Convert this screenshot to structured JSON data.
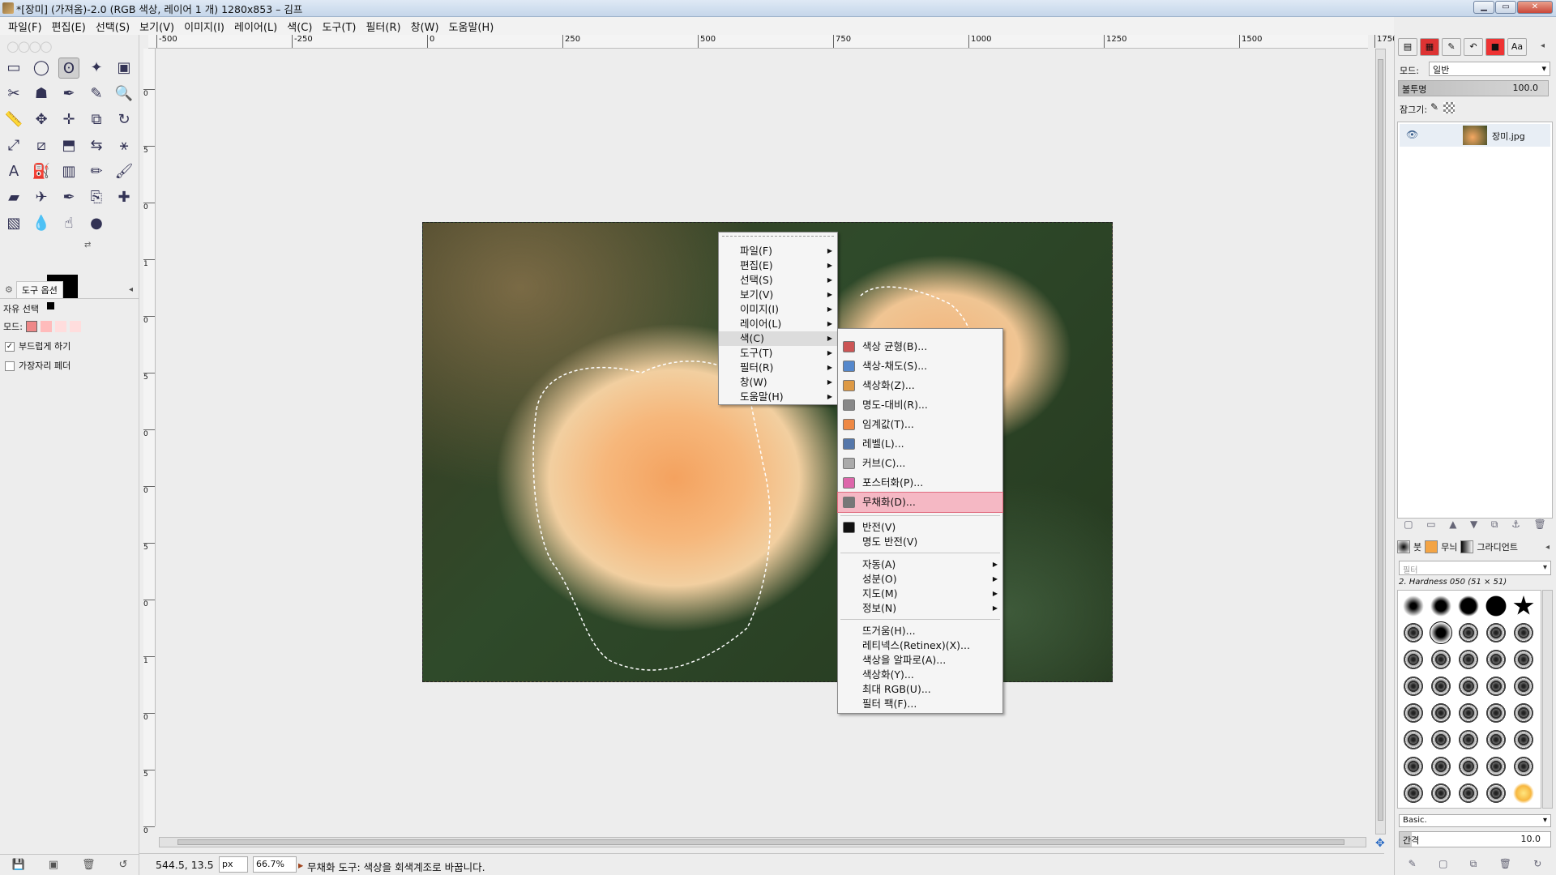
{
  "window": {
    "title": "*[장미] (가져옴)-2.0 (RGB 색상, 레이어 1 개) 1280x853 – 김프",
    "min": "▁",
    "max": "▭",
    "close": "✕"
  },
  "menubar": [
    "파일(F)",
    "편집(E)",
    "선택(S)",
    "보기(V)",
    "이미지(I)",
    "레이어(L)",
    "색(C)",
    "도구(T)",
    "필터(R)",
    "창(W)",
    "도움말(H)"
  ],
  "toolbox": {
    "icons": [
      "rect-select",
      "ellipse-select",
      "free-select",
      "fuzzy-select",
      "color-select",
      "scissors",
      "foreground-select",
      "paths",
      "color-picker",
      "zoom",
      "measure",
      "move",
      "align",
      "crop",
      "rotate",
      "scale",
      "shear",
      "perspective",
      "flip",
      "cage",
      "text",
      "bucket-fill",
      "blend",
      "pencil",
      "paintbrush",
      "eraser",
      "airbrush",
      "ink",
      "clone",
      "heal",
      "perspective-clone",
      "blur",
      "smudge",
      "dodge-burn"
    ],
    "options_tab": "도구 옵션",
    "tool_name": "자유 선택",
    "mode_label": "모드:",
    "antialias_label": "부드럽게 하기",
    "feather_label": "가장자리 페더"
  },
  "ruler": {
    "h_labels": [
      "-500",
      "-250",
      "0",
      "250",
      "500",
      "750",
      "1000",
      "1250",
      "1500",
      "1750"
    ],
    "v_labels": [
      "0",
      "5",
      "0",
      "1",
      "0",
      "5",
      "0",
      "0",
      "5",
      "0",
      "1",
      "0",
      "5",
      "0"
    ]
  },
  "status": {
    "coords": "544.5, 13.5",
    "unit": "px",
    "zoom": "66.7%",
    "message": "무채화 도구: 색상을 회색계조로 바꿉니다."
  },
  "context_menu": {
    "items": [
      {
        "label": "파일(F)",
        "sub": true
      },
      {
        "label": "편집(E)",
        "sub": true
      },
      {
        "label": "선택(S)",
        "sub": true
      },
      {
        "label": "보기(V)",
        "sub": true
      },
      {
        "label": "이미지(I)",
        "sub": true
      },
      {
        "label": "레이어(L)",
        "sub": true
      },
      {
        "label": "색(C)",
        "sub": true,
        "active": true
      },
      {
        "label": "도구(T)",
        "sub": true
      },
      {
        "label": "필터(R)",
        "sub": true
      },
      {
        "label": "창(W)",
        "sub": true
      },
      {
        "label": "도움말(H)",
        "sub": true
      }
    ]
  },
  "color_menu": {
    "items": [
      {
        "label": "색상 균형(B)...",
        "icon": "color-balance-icon"
      },
      {
        "label": "색상-채도(S)...",
        "icon": "hue-saturation-icon"
      },
      {
        "label": "색상화(Z)...",
        "icon": "colorize-icon"
      },
      {
        "label": "명도-대비(R)...",
        "icon": "brightness-contrast-icon"
      },
      {
        "label": "임계값(T)...",
        "icon": "threshold-icon"
      },
      {
        "label": "레벨(L)...",
        "icon": "levels-icon"
      },
      {
        "label": "커브(C)...",
        "icon": "curves-icon"
      },
      {
        "label": "포스터화(P)...",
        "icon": "posterize-icon"
      },
      {
        "label": "무채화(D)...",
        "icon": "desaturate-icon",
        "highlight": true
      },
      {
        "label": "반전(V)",
        "icon": "invert-icon",
        "sep_before": true
      },
      {
        "label": "명도 반전(V)"
      },
      {
        "label": "자동(A)",
        "sub": true,
        "sep_before": true
      },
      {
        "label": "성분(O)",
        "sub": true
      },
      {
        "label": "지도(M)",
        "sub": true
      },
      {
        "label": "정보(N)",
        "sub": true
      },
      {
        "label": "뜨거움(H)...",
        "sep_before": true
      },
      {
        "label": "레티넥스(Retinex)(X)..."
      },
      {
        "label": "색상을 알파로(A)..."
      },
      {
        "label": "색상화(Y)..."
      },
      {
        "label": "최대 RGB(U)..."
      },
      {
        "label": "필터 팩(F)..."
      }
    ]
  },
  "layers": {
    "mode_label": "모드:",
    "mode_value": "일반",
    "opacity_label": "불투명",
    "opacity_value": "100.0",
    "lock_label": "잠그기:",
    "layer_name": "장미.jpg"
  },
  "brushes": {
    "tab_brush": "붓",
    "tab_pattern": "무늬",
    "tab_gradient": "그라디언트",
    "filter_placeholder": "필터",
    "brush_name": "2. Hardness 050 (51 × 51)",
    "preset": "Basic.",
    "spacing_label": "간격",
    "spacing_value": "10.0"
  },
  "colors": {
    "accent": "#e06c80",
    "highlight": "#f5b8c4",
    "menu_bg": "#f5f5f5"
  }
}
